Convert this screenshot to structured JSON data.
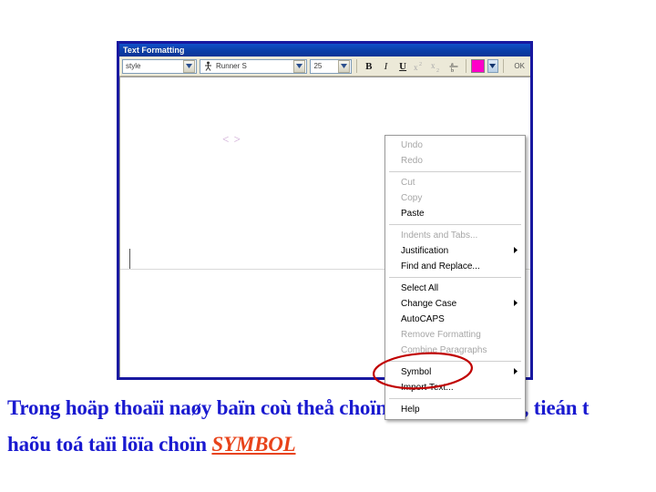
{
  "window": {
    "title": "Text Formatting"
  },
  "toolbar": {
    "style_value": "style",
    "style_placeholder": "style",
    "font_value": "Runner S",
    "font_icon": "font-glyph-icon",
    "size_value": "25",
    "bold_label": "B",
    "italic_label": "I",
    "underline_label": "U",
    "superscript_icon": "superscript-icon",
    "subscript_icon": "subscript-icon",
    "fraction_icon": "fraction-icon",
    "color_swatch_hex": "#ff00c8",
    "ok_label": "OK"
  },
  "document": {
    "angle_glyph": "< >"
  },
  "context_menu": {
    "groups": [
      {
        "items": [
          {
            "label": "Undo",
            "enabled": false,
            "submenu": false
          },
          {
            "label": "Redo",
            "enabled": false,
            "submenu": false
          }
        ]
      },
      {
        "items": [
          {
            "label": "Cut",
            "enabled": false,
            "submenu": false
          },
          {
            "label": "Copy",
            "enabled": false,
            "submenu": false
          },
          {
            "label": "Paste",
            "enabled": true,
            "submenu": false
          }
        ]
      },
      {
        "items": [
          {
            "label": "Indents and Tabs...",
            "enabled": false,
            "submenu": false
          },
          {
            "label": "Justification",
            "enabled": true,
            "submenu": true
          },
          {
            "label": "Find and Replace...",
            "enabled": true,
            "submenu": false
          }
        ]
      },
      {
        "items": [
          {
            "label": "Select All",
            "enabled": true,
            "submenu": false
          },
          {
            "label": "Change Case",
            "enabled": true,
            "submenu": true
          },
          {
            "label": "AutoCAPS",
            "enabled": true,
            "submenu": false
          },
          {
            "label": "Remove Formatting",
            "enabled": false,
            "submenu": false
          },
          {
            "label": "Combine Paragraphs",
            "enabled": false,
            "submenu": false
          }
        ]
      },
      {
        "items": [
          {
            "label": "Symbol",
            "enabled": true,
            "submenu": true
          },
          {
            "label": "Import Text...",
            "enabled": true,
            "submenu": false
          }
        ]
      },
      {
        "items": [
          {
            "label": "Help",
            "enabled": true,
            "submenu": false
          }
        ]
      }
    ]
  },
  "annotation": {
    "ellipse_color": "#c00000",
    "target_item": "Symbol"
  },
  "caption": {
    "line1": "Trong hoäp thoaïi naøy baïn coù theå choïn caùc kyù hieäu, tieán t",
    "line2_prefix": "haõu toá taïi löïa choïn ",
    "line2_emphasis": "SYMBOL",
    "text_color": "#1a1ad0",
    "emphasis_color": "#e8431a"
  }
}
